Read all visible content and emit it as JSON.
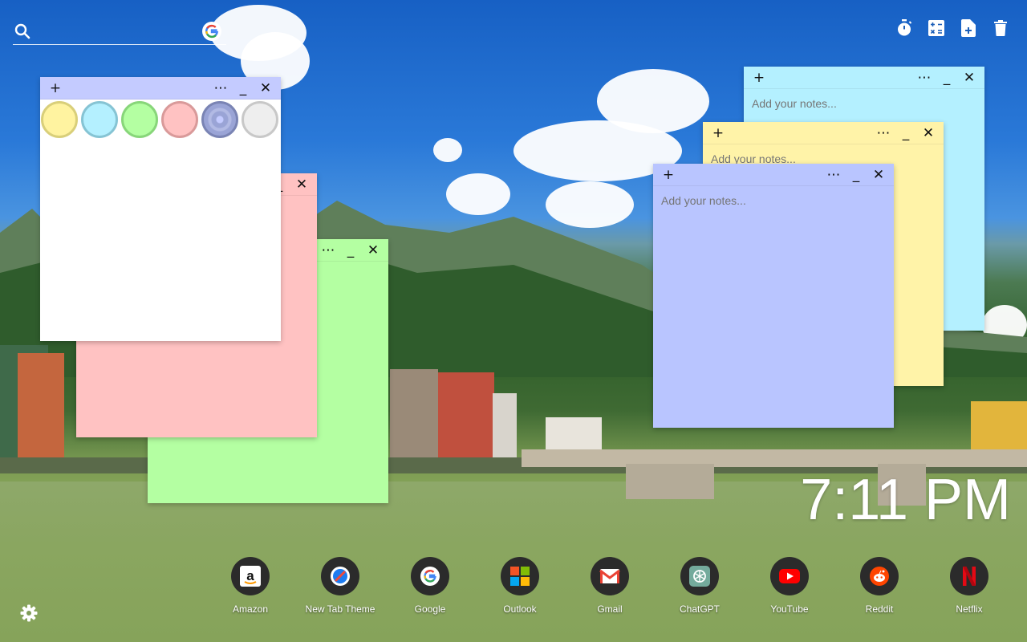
{
  "search": {
    "placeholder": ""
  },
  "tools": [
    {
      "name": "timer-icon"
    },
    {
      "name": "calculator-icon"
    },
    {
      "name": "new-note-icon"
    },
    {
      "name": "trash-icon"
    }
  ],
  "notes": {
    "white": {
      "color": "#ffffff"
    },
    "pink": {
      "color": "#ffc2c2"
    },
    "green": {
      "color": "#b4ffa2"
    },
    "cyan": {
      "color": "#b4f0ff",
      "placeholder": "Add your notes..."
    },
    "yellow": {
      "color": "#fff3a8",
      "placeholder": "Add your notes..."
    },
    "blue": {
      "color": "#b9c5ff",
      "placeholder": "Add your notes..."
    }
  },
  "palette": [
    {
      "fill": "#fff3a0",
      "ring": "#d9cf7a"
    },
    {
      "fill": "#b4f0ff",
      "ring": "#86c4d4"
    },
    {
      "fill": "#b4ffa2",
      "ring": "#88d67a"
    },
    {
      "fill": "#ffc2c2",
      "ring": "#d99a9a"
    },
    {
      "fill": "#9aa4d6",
      "ring": "#7a84b4"
    },
    {
      "fill": "#eeeeee",
      "ring": "#c8c8c8"
    }
  ],
  "clock": {
    "time": "7:11 PM"
  },
  "shortcuts": [
    {
      "label": "Amazon"
    },
    {
      "label": "New Tab Theme"
    },
    {
      "label": "Google"
    },
    {
      "label": "Outlook"
    },
    {
      "label": "Gmail"
    },
    {
      "label": "ChatGPT"
    },
    {
      "label": "YouTube"
    },
    {
      "label": "Reddit"
    },
    {
      "label": "Netflix"
    }
  ]
}
